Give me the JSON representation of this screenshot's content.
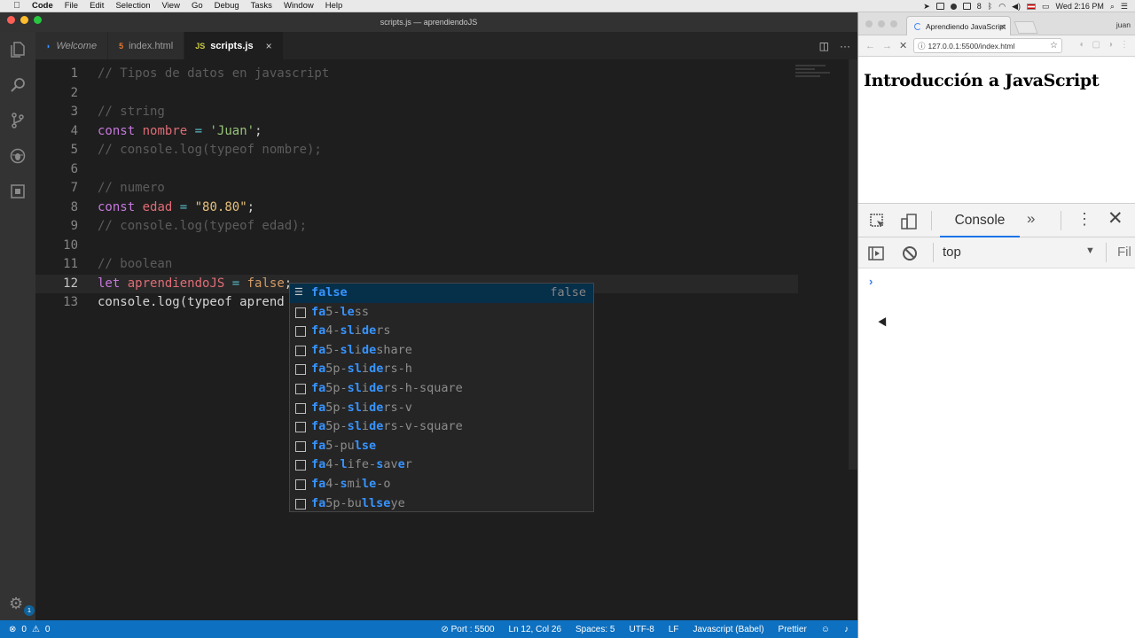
{
  "menubar": {
    "apple": "",
    "items": [
      "Code",
      "File",
      "Edit",
      "Selection",
      "View",
      "Go",
      "Debug",
      "Tasks",
      "Window",
      "Help"
    ],
    "battery_num": "8",
    "clock": "Wed 2:16 PM"
  },
  "vscode": {
    "window_title": "scripts.js — aprendiendoJS",
    "tabs": [
      {
        "label": "Welcome",
        "icon": "vscode-icon"
      },
      {
        "label": "index.html",
        "icon": "html-file-icon"
      },
      {
        "label": "scripts.js",
        "icon": "js-file-icon",
        "active": true
      }
    ],
    "tab_icon_glyphs": {
      "welcome": "◗",
      "html": "5",
      "js": "JS"
    },
    "activity_badge": "1",
    "editor": {
      "lines": [
        {
          "n": "1",
          "text": "// Tipos de datos en javascript"
        },
        {
          "n": "2",
          "text": ""
        },
        {
          "n": "3",
          "text": "// string"
        },
        {
          "n": "4",
          "kw": "const",
          "var": "nombre",
          "op": "=",
          "str": "'Juan'",
          "end": ";"
        },
        {
          "n": "5",
          "text": "// console.log(typeof nombre);"
        },
        {
          "n": "6",
          "text": ""
        },
        {
          "n": "7",
          "text": "// numero"
        },
        {
          "n": "8",
          "kw": "const",
          "var": "edad",
          "op": "=",
          "str": "\"80.80\"",
          "end": ";"
        },
        {
          "n": "9",
          "text": "// console.log(typeof edad);"
        },
        {
          "n": "10",
          "text": ""
        },
        {
          "n": "11",
          "text": "// boolean"
        },
        {
          "n": "12",
          "kw": "let",
          "var": "aprendiendoJS",
          "op": "=",
          "str": "false",
          "end": ";"
        },
        {
          "n": "13",
          "text": "console.log(typeof aprend"
        }
      ]
    },
    "suggest": {
      "items": [
        {
          "match": "false",
          "rest": "",
          "detail": "false"
        },
        {
          "match": "fa",
          "rest": "5-",
          "match2": "le",
          "rest2": "ss"
        },
        {
          "match": "fa",
          "rest": "4-",
          "match2": "sl",
          "rest2": "i",
          "match3": "de",
          "rest3": "rs"
        },
        {
          "match": "fa",
          "rest": "5-",
          "match2": "sl",
          "rest2": "i",
          "match3": "de",
          "rest3": "share"
        },
        {
          "match": "fa",
          "rest": "5p-",
          "match2": "sl",
          "rest2": "i",
          "match3": "de",
          "rest3": "rs-h"
        },
        {
          "match": "fa",
          "rest": "5p-",
          "match2": "sl",
          "rest2": "i",
          "match3": "de",
          "rest3": "rs-h-square"
        },
        {
          "match": "fa",
          "rest": "5p-",
          "match2": "sl",
          "rest2": "i",
          "match3": "de",
          "rest3": "rs-v"
        },
        {
          "match": "fa",
          "rest": "5p-",
          "match2": "sl",
          "rest2": "i",
          "match3": "de",
          "rest3": "rs-v-square"
        },
        {
          "match": "fa",
          "rest": "5-pu",
          "match2": "lse",
          "rest2": ""
        },
        {
          "match": "fa",
          "rest": "4-",
          "match2": "l",
          "rest2": "ife-",
          "match3": "s",
          "rest3": "av",
          "match4": "e",
          "rest4": "r"
        },
        {
          "match": "fa",
          "rest": "4-",
          "match2": "s",
          "rest2": "mi",
          "match3": "le",
          "rest3": "-o"
        },
        {
          "match": "fa",
          "rest": "5p-bu",
          "match2": "lls",
          "rest2": "",
          "match3": "e",
          "rest3": "ye"
        }
      ]
    },
    "status": {
      "errors": "0",
      "warnings": "0",
      "port": "Port : 5500",
      "position": "Ln 12, Col 26",
      "spaces": "Spaces: 5",
      "encoding": "UTF-8",
      "eol": "LF",
      "language": "Javascript (Babel)",
      "formatter": "Prettier"
    }
  },
  "browser": {
    "tab_title": "Aprendiendo JavaScript",
    "user": "juan",
    "url": "127.0.0.1:5500/index.html",
    "page_heading": "Introducción a JavaScript",
    "devtools": {
      "active_tab": "Console",
      "more": "»",
      "context": "top",
      "filter_placeholder": "Fil",
      "prompt": "›"
    }
  },
  "colors": {
    "statusbar": "#0e70c0",
    "keyword": "#c678dd",
    "variable": "#e06c75",
    "string": "#98c379",
    "match_highlight": "#3794ff"
  }
}
